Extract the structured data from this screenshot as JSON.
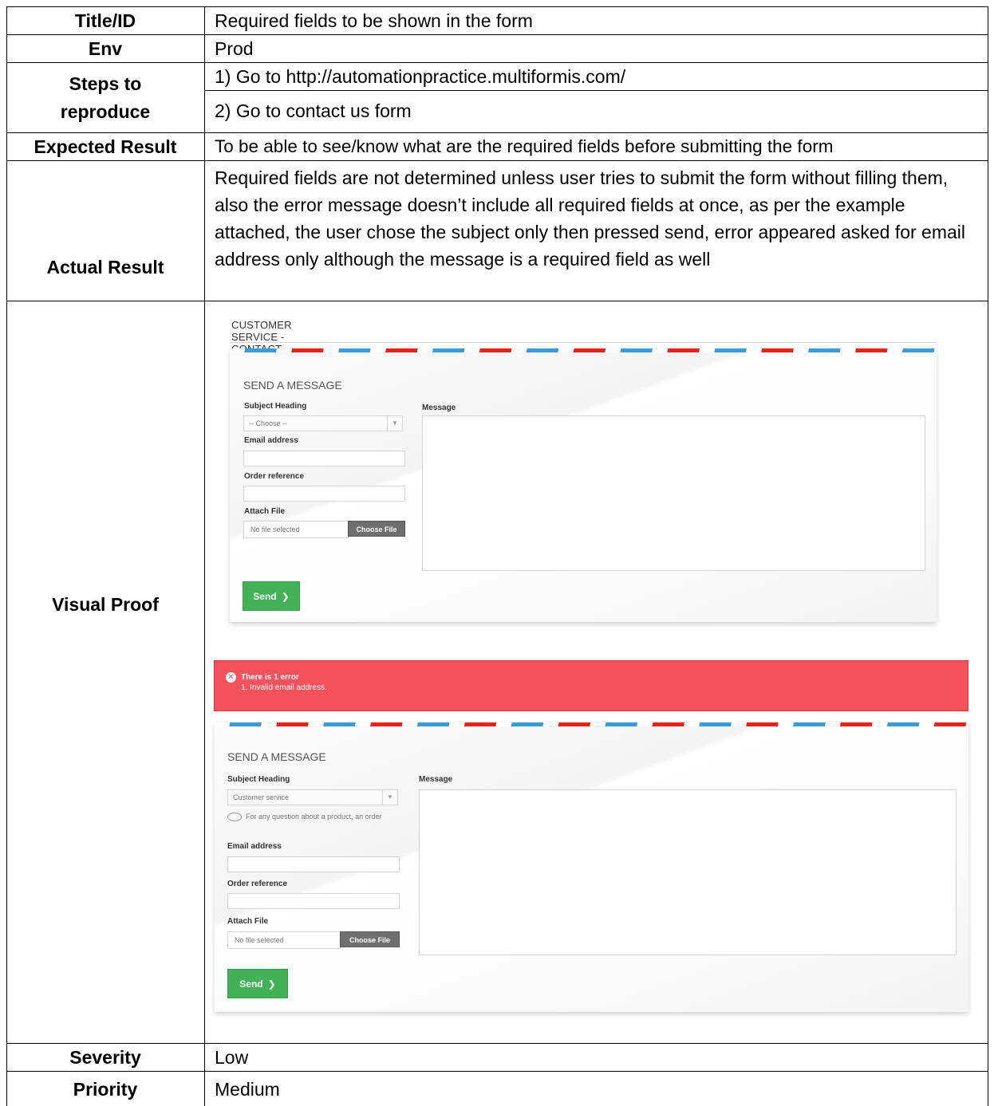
{
  "report": {
    "rows": [
      {
        "label": "Title/ID",
        "value": "Required fields to be shown in the form"
      },
      {
        "label": "Env",
        "value": "Prod"
      },
      {
        "label": "Steps to reproduce",
        "steps": [
          "1) Go to http://automationpractice.multiformis.com/",
          "2) Go to contact us form"
        ]
      },
      {
        "label": "Expected Result",
        "value": "To be able to see/know what are the required fields before submitting the form"
      },
      {
        "label": "Actual Result",
        "value": "Required fields are not determined unless user tries to submit the form without filling them, also the error message doesn’t include all required fields at once, as per the example attached, the user chose the subject only then pressed send, error appeared asked for email address only although the message is a required field as well"
      },
      {
        "label": "Visual Proof"
      },
      {
        "label": "Severity",
        "value": "Low"
      },
      {
        "label": "Priority",
        "value": "Medium"
      }
    ]
  },
  "screenshot": {
    "breadcrumb": "CUSTOMER SERVICE - CONTACT US",
    "form1": {
      "heading": "SEND A MESSAGE",
      "subject_label": "Subject Heading",
      "subject_value": "-- Choose --",
      "email_label": "Email address",
      "order_label": "Order reference",
      "attach_label": "Attach File",
      "file_text": "No file selected",
      "choose_label": "Choose File",
      "message_label": "Message",
      "send_label": "Send"
    },
    "error": {
      "title": "There is 1 error",
      "item": "1. Invalid email address."
    },
    "form2": {
      "heading": "SEND A MESSAGE",
      "subject_label": "Subject Heading",
      "subject_value": "Customer service",
      "hint": "For any question about a product, an order",
      "email_label": "Email address",
      "order_label": "Order reference",
      "attach_label": "Attach File",
      "file_text": "No file selected",
      "choose_label": "Choose File",
      "message_label": "Message",
      "send_label": "Send"
    }
  }
}
